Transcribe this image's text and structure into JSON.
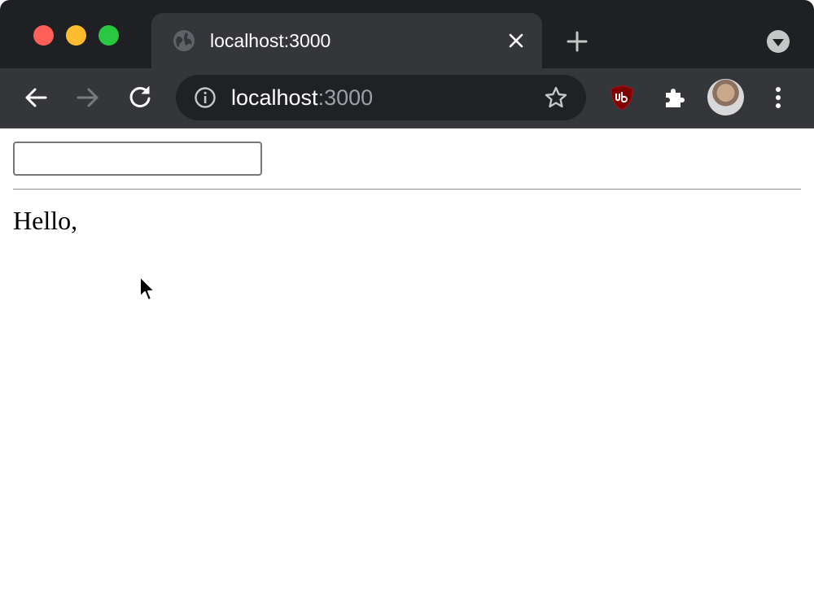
{
  "browser": {
    "tab": {
      "title": "localhost:3000",
      "favicon": "globe-icon"
    },
    "omnibox": {
      "host": "localhost",
      "port": ":3000"
    },
    "icons": {
      "back": "arrow-left-icon",
      "forward": "arrow-right-icon",
      "reload": "reload-icon",
      "info": "info-icon",
      "bookmark": "star-icon",
      "extension_ublock": "ublock-shield-icon",
      "extensions": "puzzle-icon",
      "menu": "kebab-menu-icon",
      "new_tab": "plus-icon",
      "tab_search": "chevron-down-circle-icon",
      "close_tab": "close-icon"
    },
    "colors": {
      "traffic_red": "#fe5f57",
      "traffic_yellow": "#febc2e",
      "traffic_green": "#28c840",
      "ublock_red": "#800000",
      "chrome_dark": "#35363a"
    }
  },
  "page": {
    "input_value": "",
    "greeting": "Hello,"
  }
}
